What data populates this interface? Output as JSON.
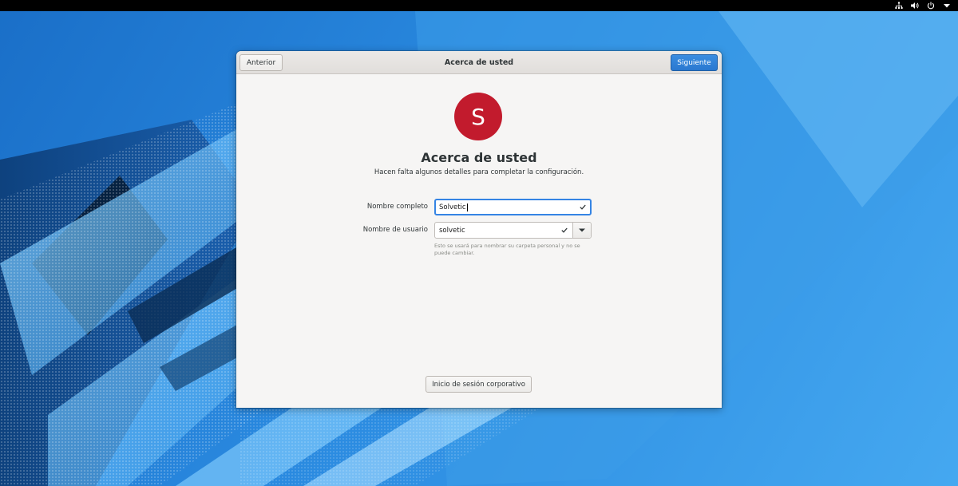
{
  "topbar": {
    "icons": [
      "network-icon",
      "volume-icon",
      "power-icon",
      "chevron-down-icon"
    ]
  },
  "window": {
    "title": "Acerca de usted",
    "back_label": "Anterior",
    "next_label": "Siguiente"
  },
  "avatar": {
    "initial": "S",
    "color": "#c21b2d"
  },
  "page": {
    "heading": "Acerca de usted",
    "subheading": "Hacen falta algunos detalles para completar la configuración."
  },
  "form": {
    "fullname_label": "Nombre completo",
    "fullname_value": "Solvetic",
    "username_label": "Nombre de usuario",
    "username_value": "solvetic",
    "username_hint": "Esto se usará para nombrar su carpeta personal y no se puede cambiar."
  },
  "enterprise_login_label": "Inicio de sesión corporativo",
  "colors": {
    "accent": "#3584e4",
    "topbar": "#000000",
    "window_bg": "#f6f5f4"
  }
}
